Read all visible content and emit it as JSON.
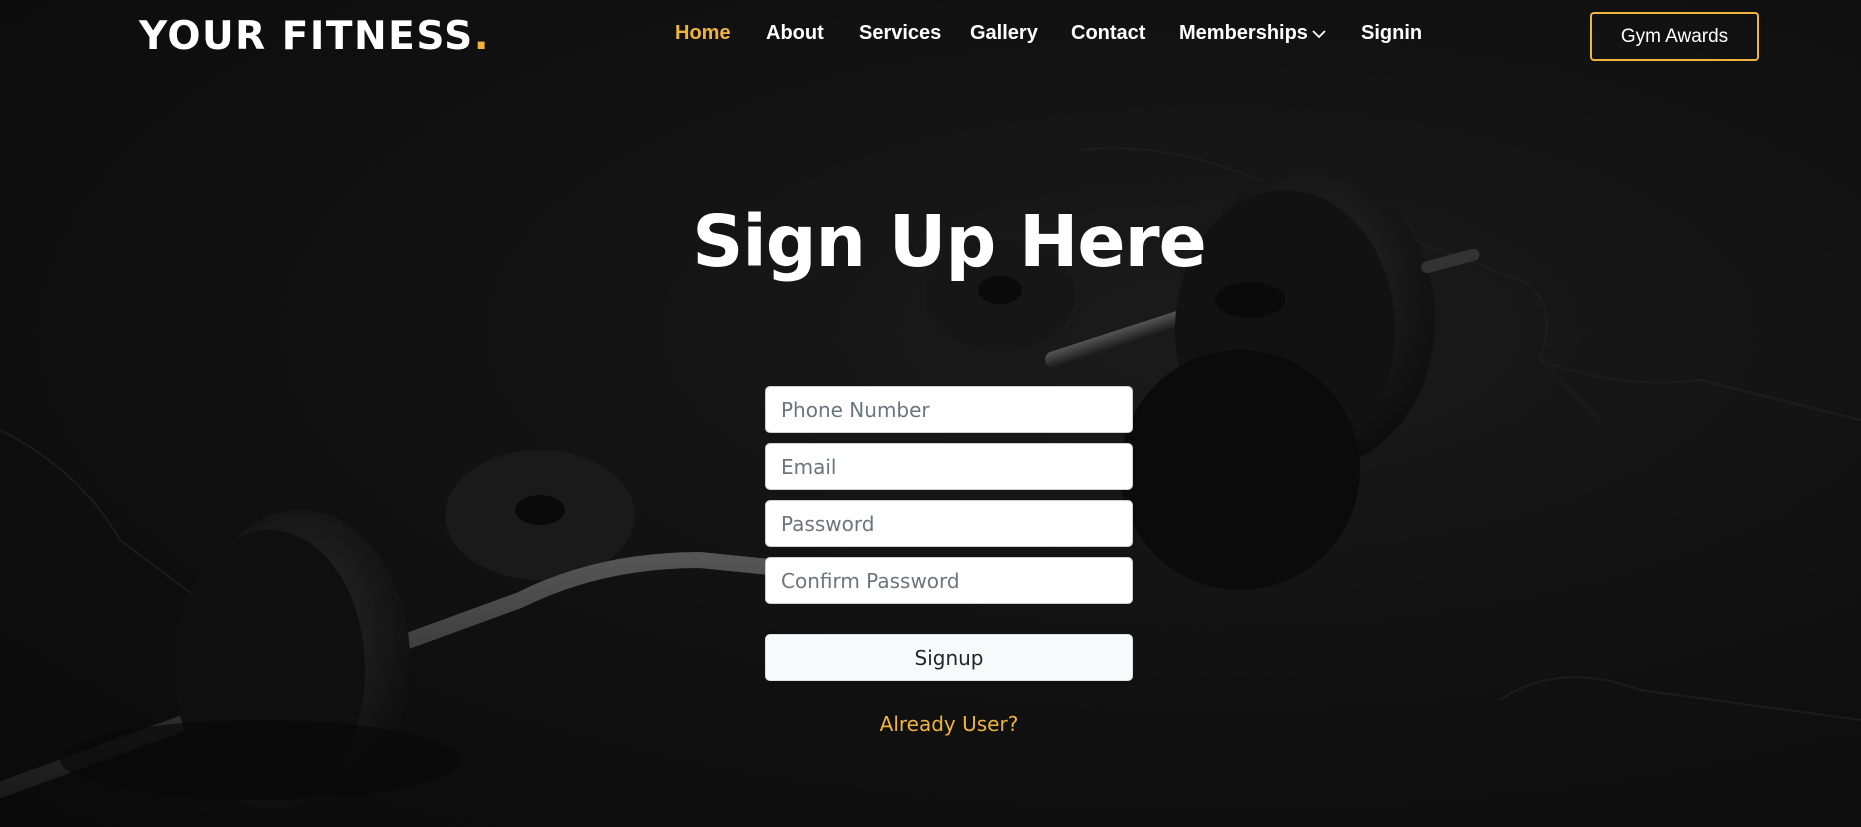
{
  "brand": {
    "name": "YOUR FITNESS",
    "dot": ".",
    "accent": "#f0b43c"
  },
  "nav": {
    "items": [
      {
        "label": "Home",
        "active": true
      },
      {
        "label": "About"
      },
      {
        "label": "Services"
      },
      {
        "label": "Gallery"
      },
      {
        "label": "Contact"
      },
      {
        "label": "Memberships",
        "icon": "chevron-down-icon"
      },
      {
        "label": "Signin"
      }
    ],
    "cta_label": "Gym Awards"
  },
  "page": {
    "title": "Sign Up Here"
  },
  "form": {
    "phone_placeholder": "Phone Number",
    "email_placeholder": "Email",
    "password_placeholder": "Password",
    "confirm_placeholder": "Confirm Password",
    "submit_label": "Signup",
    "already_link": "Already User?"
  }
}
